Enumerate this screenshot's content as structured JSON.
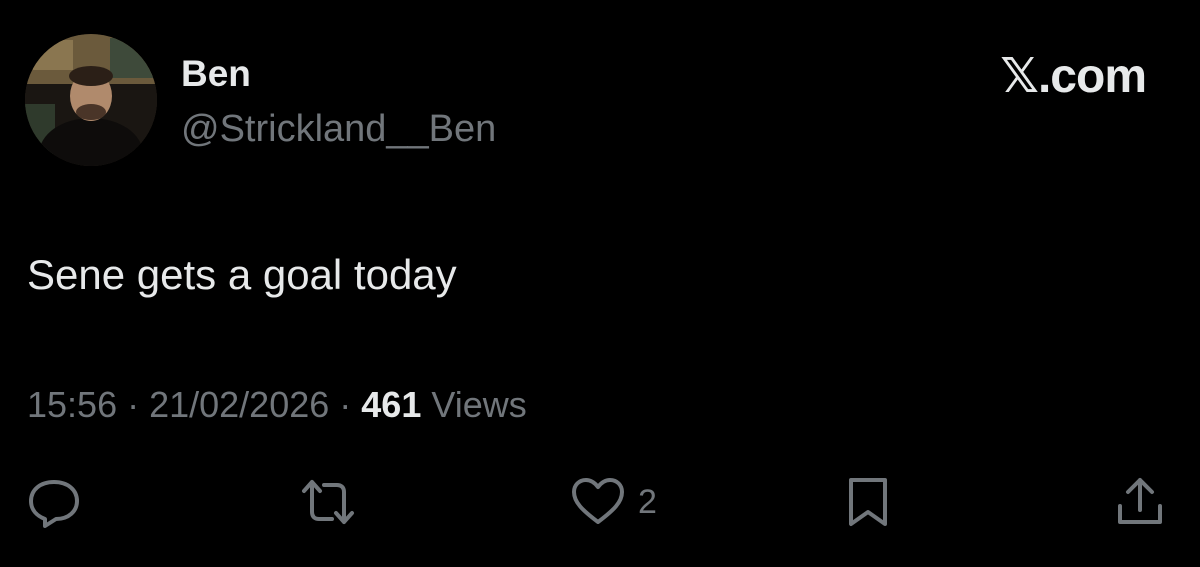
{
  "author": {
    "display_name": "Ben",
    "handle": "@Strickland__Ben",
    "avatar_icon": "profile-photo"
  },
  "brand": "𝕏.com",
  "tweet": {
    "text": "Sene gets a goal today"
  },
  "meta": {
    "time": "15:56",
    "separator": " · ",
    "date": "21/02/2026",
    "views_count": "461",
    "views_label": "Views"
  },
  "actions": {
    "reply_icon": "reply-icon",
    "retweet_icon": "retweet-icon",
    "like_icon": "heart-icon",
    "like_count": "2",
    "bookmark_icon": "bookmark-icon",
    "share_icon": "share-icon"
  },
  "colors": {
    "background": "#000000",
    "primary_text": "#e7e9ea",
    "secondary_text": "#71767b"
  }
}
